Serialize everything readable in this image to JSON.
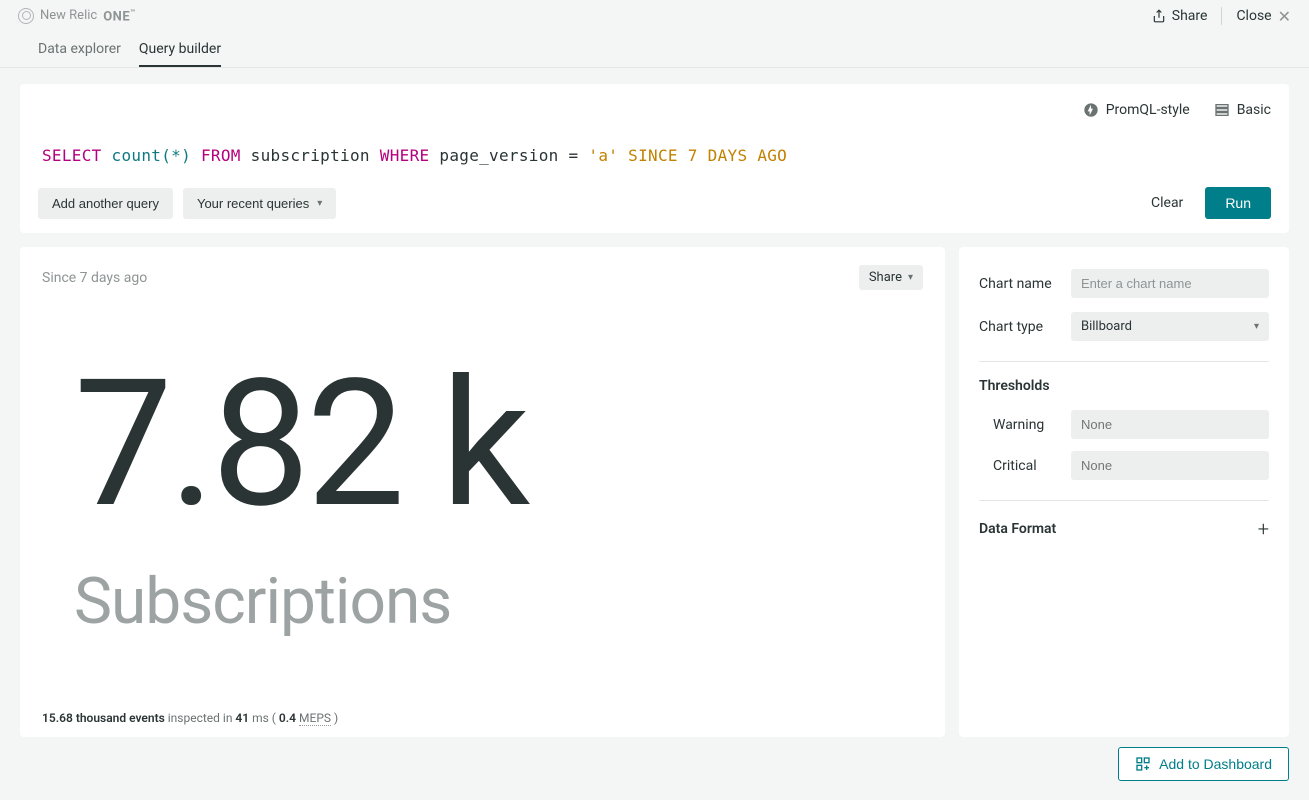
{
  "brand": {
    "name": "New Relic",
    "suffix": "ONE",
    "tm": "™"
  },
  "top": {
    "share": "Share",
    "close": "Close"
  },
  "tabs": {
    "data_explorer": "Data explorer",
    "query_builder": "Query builder"
  },
  "query_opts": {
    "promql": "PromQL-style",
    "basic": "Basic"
  },
  "query": {
    "select": "SELECT",
    "func": "count",
    "star": "*",
    "from": "FROM",
    "table": "subscription",
    "where": "WHERE",
    "field": "page_version",
    "op": "=",
    "value": "'a'",
    "since": "SINCE",
    "num": "7",
    "days": "DAYS",
    "ago": "AGO"
  },
  "buttons": {
    "add_another": "Add another query",
    "recent": "Your recent queries",
    "clear": "Clear",
    "run": "Run"
  },
  "result": {
    "time": "Since 7 days ago",
    "share": "Share",
    "value": "7.82 k",
    "label": "Subscriptions",
    "footer_bold1": "15.68 thousand events",
    "footer_mid": " inspected in ",
    "footer_bold2": "41",
    "footer_ms": " ms ( ",
    "footer_bold3": "0.4 ",
    "footer_meps": "MEPS",
    "footer_end": " )"
  },
  "side": {
    "chart_name_label": "Chart name",
    "chart_name_placeholder": "Enter a chart name",
    "chart_type_label": "Chart type",
    "chart_type_value": "Billboard",
    "thresholds": "Thresholds",
    "warning": "Warning",
    "critical": "Critical",
    "none": "None",
    "data_format": "Data Format"
  },
  "bottom": {
    "add_to_dashboard": "Add to Dashboard"
  }
}
